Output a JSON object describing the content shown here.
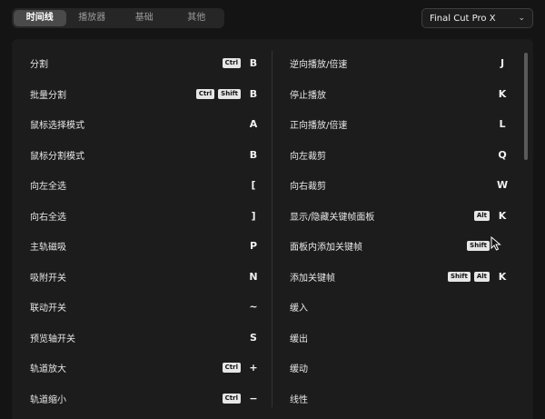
{
  "tabs": [
    "时间线",
    "播放器",
    "基础",
    "其他"
  ],
  "active_tab": 0,
  "app_select": {
    "value": "Final Cut Pro X"
  },
  "left": [
    {
      "label": "分割",
      "mods": [
        "Ctrl"
      ],
      "key": "B"
    },
    {
      "label": "批量分割",
      "mods": [
        "Ctrl",
        "Shift"
      ],
      "key": "B"
    },
    {
      "label": "鼠标选择模式",
      "mods": [],
      "key": "A"
    },
    {
      "label": "鼠标分割模式",
      "mods": [],
      "key": "B"
    },
    {
      "label": "向左全选",
      "mods": [],
      "key": "["
    },
    {
      "label": "向右全选",
      "mods": [],
      "key": "]"
    },
    {
      "label": "主轨磁吸",
      "mods": [],
      "key": "P"
    },
    {
      "label": "吸附开关",
      "mods": [],
      "key": "N"
    },
    {
      "label": "联动开关",
      "mods": [],
      "key": "~"
    },
    {
      "label": "预览轴开关",
      "mods": [],
      "key": "S"
    },
    {
      "label": "轨道放大",
      "mods": [
        "Ctrl"
      ],
      "key": "+"
    },
    {
      "label": "轨道缩小",
      "mods": [
        "Ctrl"
      ],
      "key": "−"
    }
  ],
  "right": [
    {
      "label": "逆向播放/倍速",
      "mods": [],
      "key": "J"
    },
    {
      "label": "停止播放",
      "mods": [],
      "key": "K"
    },
    {
      "label": "正向播放/倍速",
      "mods": [],
      "key": "L"
    },
    {
      "label": "向左裁剪",
      "mods": [],
      "key": "Q"
    },
    {
      "label": "向右裁剪",
      "mods": [],
      "key": "W"
    },
    {
      "label": "显示/隐藏关键帧面板",
      "mods": [
        "Alt"
      ],
      "key": "K"
    },
    {
      "label": "面板内添加关键帧",
      "mods": [
        "Shift"
      ],
      "key": ""
    },
    {
      "label": "添加关键帧",
      "mods": [
        "Shift",
        "Alt"
      ],
      "key": "K"
    },
    {
      "label": "缓入",
      "mods": [],
      "key": ""
    },
    {
      "label": "缓出",
      "mods": [],
      "key": ""
    },
    {
      "label": "缓动",
      "mods": [],
      "key": ""
    },
    {
      "label": "线性",
      "mods": [],
      "key": ""
    }
  ]
}
